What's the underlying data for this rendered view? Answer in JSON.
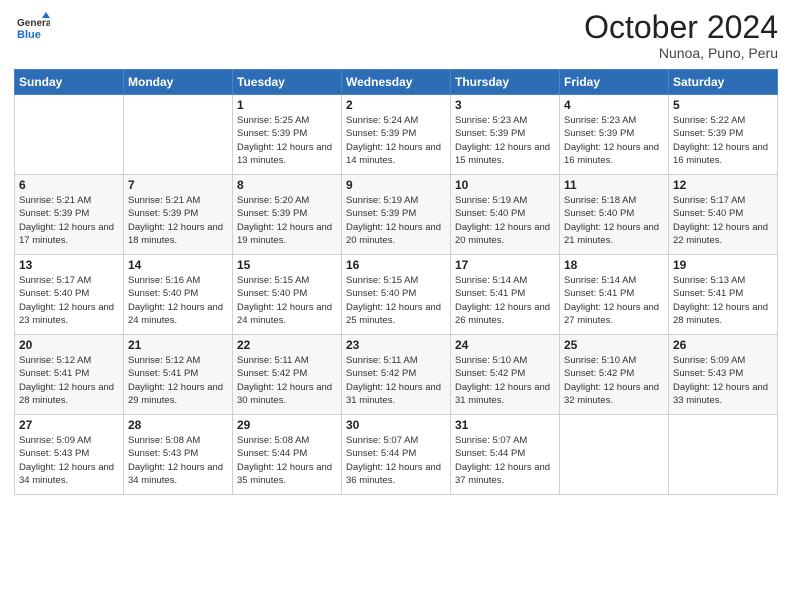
{
  "logo": {
    "general": "General",
    "blue": "Blue"
  },
  "header": {
    "month": "October 2024",
    "location": "Nunoa, Puno, Peru"
  },
  "weekdays": [
    "Sunday",
    "Monday",
    "Tuesday",
    "Wednesday",
    "Thursday",
    "Friday",
    "Saturday"
  ],
  "weeks": [
    [
      {
        "day": "",
        "info": ""
      },
      {
        "day": "",
        "info": ""
      },
      {
        "day": "1",
        "info": "Sunrise: 5:25 AM\nSunset: 5:39 PM\nDaylight: 12 hours and 13 minutes."
      },
      {
        "day": "2",
        "info": "Sunrise: 5:24 AM\nSunset: 5:39 PM\nDaylight: 12 hours and 14 minutes."
      },
      {
        "day": "3",
        "info": "Sunrise: 5:23 AM\nSunset: 5:39 PM\nDaylight: 12 hours and 15 minutes."
      },
      {
        "day": "4",
        "info": "Sunrise: 5:23 AM\nSunset: 5:39 PM\nDaylight: 12 hours and 16 minutes."
      },
      {
        "day": "5",
        "info": "Sunrise: 5:22 AM\nSunset: 5:39 PM\nDaylight: 12 hours and 16 minutes."
      }
    ],
    [
      {
        "day": "6",
        "info": "Sunrise: 5:21 AM\nSunset: 5:39 PM\nDaylight: 12 hours and 17 minutes."
      },
      {
        "day": "7",
        "info": "Sunrise: 5:21 AM\nSunset: 5:39 PM\nDaylight: 12 hours and 18 minutes."
      },
      {
        "day": "8",
        "info": "Sunrise: 5:20 AM\nSunset: 5:39 PM\nDaylight: 12 hours and 19 minutes."
      },
      {
        "day": "9",
        "info": "Sunrise: 5:19 AM\nSunset: 5:39 PM\nDaylight: 12 hours and 20 minutes."
      },
      {
        "day": "10",
        "info": "Sunrise: 5:19 AM\nSunset: 5:40 PM\nDaylight: 12 hours and 20 minutes."
      },
      {
        "day": "11",
        "info": "Sunrise: 5:18 AM\nSunset: 5:40 PM\nDaylight: 12 hours and 21 minutes."
      },
      {
        "day": "12",
        "info": "Sunrise: 5:17 AM\nSunset: 5:40 PM\nDaylight: 12 hours and 22 minutes."
      }
    ],
    [
      {
        "day": "13",
        "info": "Sunrise: 5:17 AM\nSunset: 5:40 PM\nDaylight: 12 hours and 23 minutes."
      },
      {
        "day": "14",
        "info": "Sunrise: 5:16 AM\nSunset: 5:40 PM\nDaylight: 12 hours and 24 minutes."
      },
      {
        "day": "15",
        "info": "Sunrise: 5:15 AM\nSunset: 5:40 PM\nDaylight: 12 hours and 24 minutes."
      },
      {
        "day": "16",
        "info": "Sunrise: 5:15 AM\nSunset: 5:40 PM\nDaylight: 12 hours and 25 minutes."
      },
      {
        "day": "17",
        "info": "Sunrise: 5:14 AM\nSunset: 5:41 PM\nDaylight: 12 hours and 26 minutes."
      },
      {
        "day": "18",
        "info": "Sunrise: 5:14 AM\nSunset: 5:41 PM\nDaylight: 12 hours and 27 minutes."
      },
      {
        "day": "19",
        "info": "Sunrise: 5:13 AM\nSunset: 5:41 PM\nDaylight: 12 hours and 28 minutes."
      }
    ],
    [
      {
        "day": "20",
        "info": "Sunrise: 5:12 AM\nSunset: 5:41 PM\nDaylight: 12 hours and 28 minutes."
      },
      {
        "day": "21",
        "info": "Sunrise: 5:12 AM\nSunset: 5:41 PM\nDaylight: 12 hours and 29 minutes."
      },
      {
        "day": "22",
        "info": "Sunrise: 5:11 AM\nSunset: 5:42 PM\nDaylight: 12 hours and 30 minutes."
      },
      {
        "day": "23",
        "info": "Sunrise: 5:11 AM\nSunset: 5:42 PM\nDaylight: 12 hours and 31 minutes."
      },
      {
        "day": "24",
        "info": "Sunrise: 5:10 AM\nSunset: 5:42 PM\nDaylight: 12 hours and 31 minutes."
      },
      {
        "day": "25",
        "info": "Sunrise: 5:10 AM\nSunset: 5:42 PM\nDaylight: 12 hours and 32 minutes."
      },
      {
        "day": "26",
        "info": "Sunrise: 5:09 AM\nSunset: 5:43 PM\nDaylight: 12 hours and 33 minutes."
      }
    ],
    [
      {
        "day": "27",
        "info": "Sunrise: 5:09 AM\nSunset: 5:43 PM\nDaylight: 12 hours and 34 minutes."
      },
      {
        "day": "28",
        "info": "Sunrise: 5:08 AM\nSunset: 5:43 PM\nDaylight: 12 hours and 34 minutes."
      },
      {
        "day": "29",
        "info": "Sunrise: 5:08 AM\nSunset: 5:44 PM\nDaylight: 12 hours and 35 minutes."
      },
      {
        "day": "30",
        "info": "Sunrise: 5:07 AM\nSunset: 5:44 PM\nDaylight: 12 hours and 36 minutes."
      },
      {
        "day": "31",
        "info": "Sunrise: 5:07 AM\nSunset: 5:44 PM\nDaylight: 12 hours and 37 minutes."
      },
      {
        "day": "",
        "info": ""
      },
      {
        "day": "",
        "info": ""
      }
    ]
  ]
}
